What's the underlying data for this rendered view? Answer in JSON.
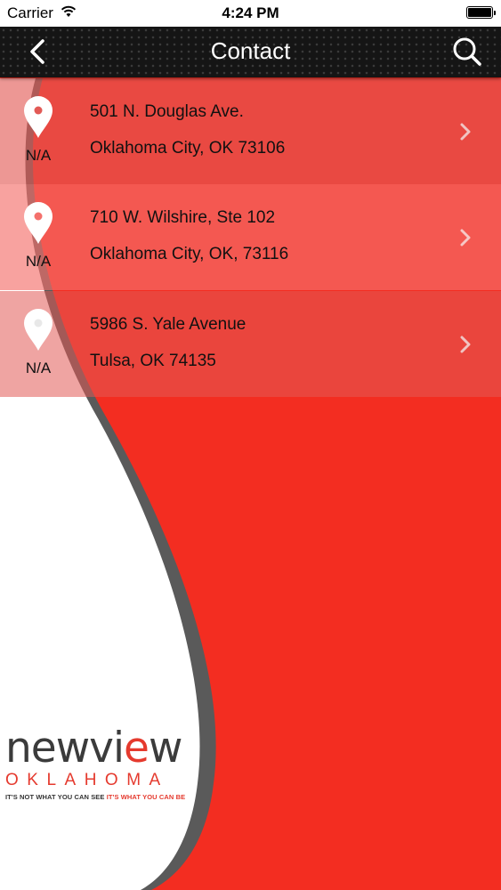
{
  "status_bar": {
    "carrier": "Carrier",
    "time": "4:24 PM"
  },
  "nav": {
    "title": "Contact",
    "back_icon": "chevron-left-icon",
    "search_icon": "magnifier-icon"
  },
  "locations": [
    {
      "distance": "N/A",
      "address_line1": "501 N. Douglas Ave.",
      "address_line2": "Oklahoma City, OK 73106"
    },
    {
      "distance": "N/A",
      "address_line1": "710 W. Wilshire, Ste 102",
      "address_line2": "Oklahoma City, OK, 73116"
    },
    {
      "distance": "N/A",
      "address_line1": "5986 S. Yale Avenue",
      "address_line2": "Tulsa, OK 74135"
    }
  ],
  "logo": {
    "word_before": "newvi",
    "word_e": "e",
    "word_after": "w",
    "state": "OKLAHOMA",
    "tagline_dark": "IT'S NOT WHAT YOU CAN SEE ",
    "tagline_red": "IT'S WHAT YOU CAN BE"
  },
  "colors": {
    "brand_red": "#f32d21",
    "accent_red": "#e53a2e",
    "nav_bg": "#151515",
    "swoosh_gray": "#555555"
  }
}
